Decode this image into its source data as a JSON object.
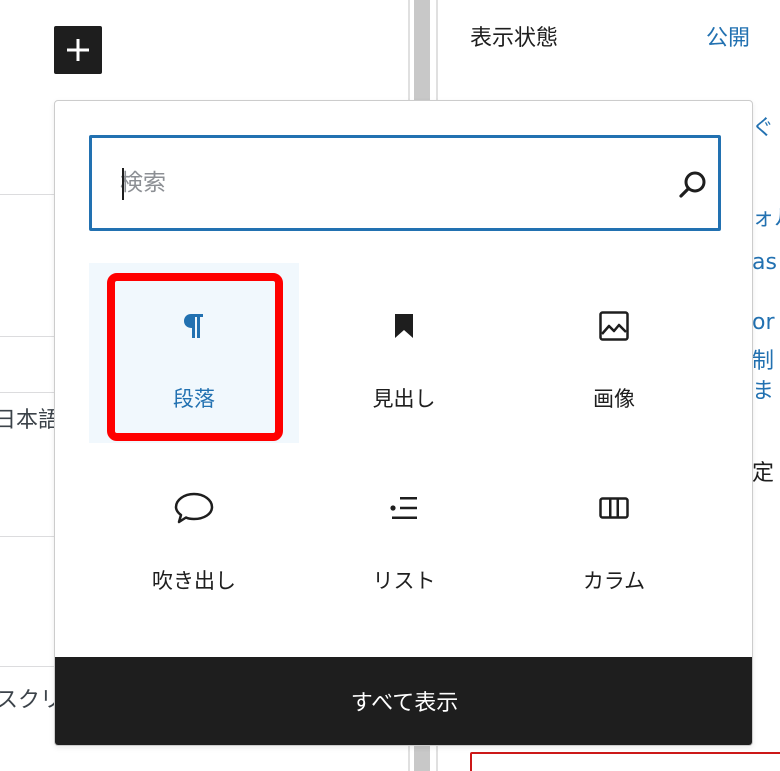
{
  "editor": {
    "background_fragments": [
      "日本語",
      "スクリ"
    ]
  },
  "sidebar": {
    "visibility_label": "表示状態",
    "visibility_value": "公開",
    "fragments": [
      "ぐ",
      "ォル",
      "as",
      "or",
      "制",
      "ま",
      "定"
    ]
  },
  "inserter": {
    "search": {
      "placeholder": "検索",
      "value": ""
    },
    "blocks": [
      {
        "label": "段落",
        "icon": "paragraph-icon",
        "selected": true
      },
      {
        "label": "見出し",
        "icon": "bookmark-icon",
        "selected": false
      },
      {
        "label": "画像",
        "icon": "image-icon",
        "selected": false
      },
      {
        "label": "吹き出し",
        "icon": "speech-bubble-icon",
        "selected": false
      },
      {
        "label": "リスト",
        "icon": "list-icon",
        "selected": false
      },
      {
        "label": "カラム",
        "icon": "columns-icon",
        "selected": false
      }
    ],
    "show_all_label": "すべて表示"
  },
  "colors": {
    "accent": "#2271b1",
    "dark": "#1e1e1e",
    "highlight": "#ff0000"
  }
}
